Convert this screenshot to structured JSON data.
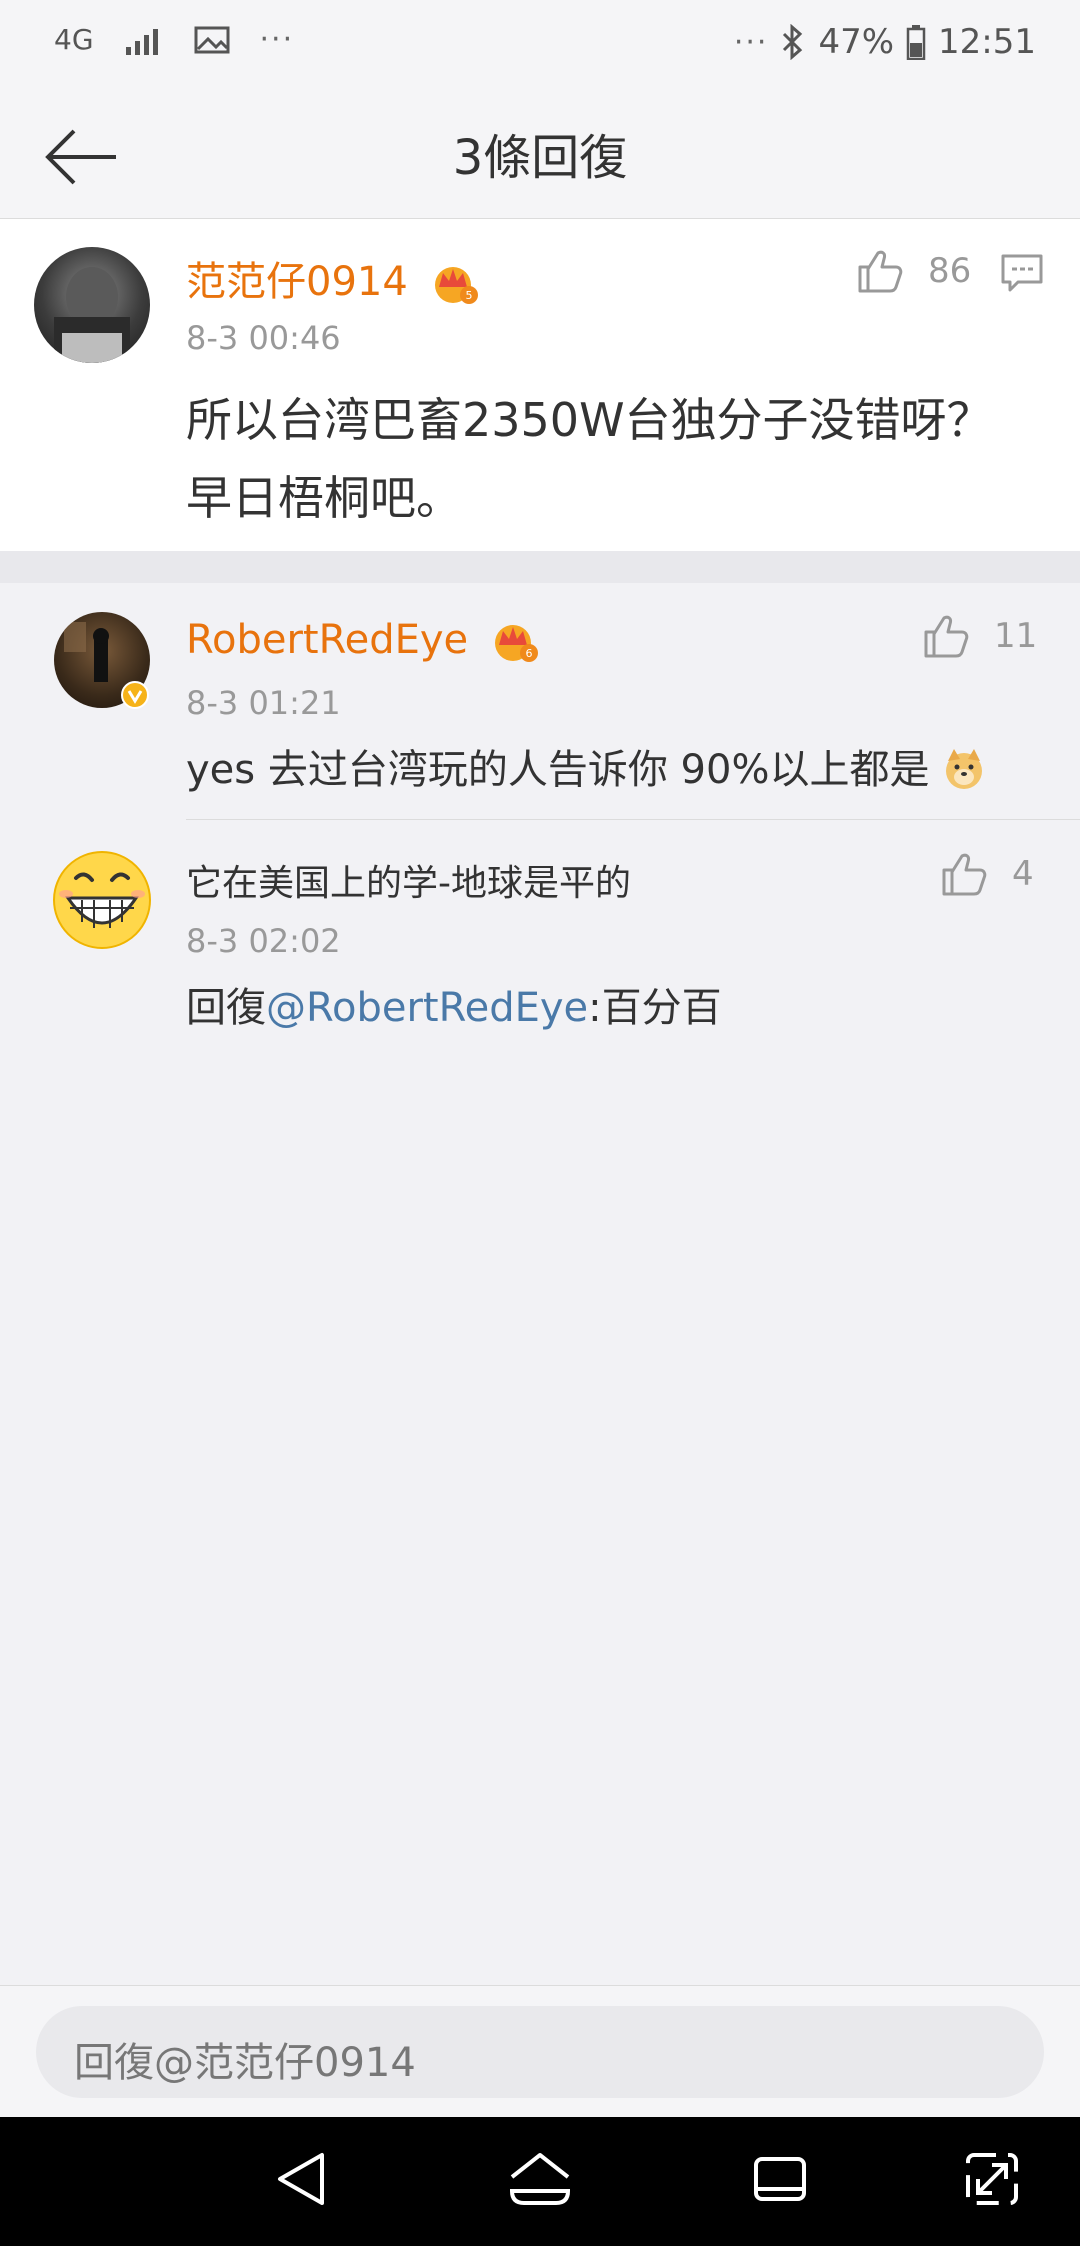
{
  "status_bar": {
    "network": "4G",
    "more": "···",
    "more_right": "···",
    "battery": "47%",
    "time": "12:51"
  },
  "nav": {
    "title": "3條回復"
  },
  "main_comment": {
    "username": "范范仔0914",
    "time": "8-3 00:46",
    "likes": "86",
    "text_line1": "所以台湾巴畜2350W台独分子没错呀？",
    "text_line2": "早日梧桐吧。"
  },
  "replies": [
    {
      "username": "RobertRedEye",
      "time": "8-3 01:21",
      "likes": "11",
      "text": "yes 去过台湾玩的人告诉你 90%以上都是"
    },
    {
      "username": "它在美国上的学-地球是平的",
      "time": "8-3 02:02",
      "likes": "4",
      "reply_prefix": "回復",
      "mention": "@RobertRedEye",
      "reply_text": ":百分百"
    }
  ],
  "input": {
    "placeholder": "回復@范范仔0914"
  },
  "colors": {
    "username": "#e8730d",
    "mention": "#4a79a8",
    "background": "#f2f2f5"
  }
}
